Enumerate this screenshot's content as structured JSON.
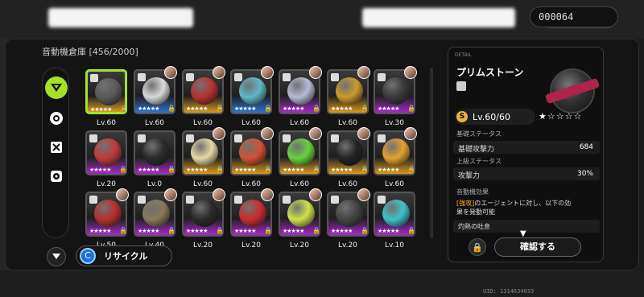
{
  "header": {
    "counter": "000064"
  },
  "storage": {
    "title": "音動機倉庫 [456/2000]"
  },
  "rail": {
    "icons": [
      "emblem-icon",
      "disc-icon",
      "crossed-box-icon",
      "disc-tool-icon"
    ]
  },
  "grid": {
    "rows": [
      [
        {
          "rank": "s",
          "level": "Lv.60",
          "avatar": false,
          "selected": true,
          "orb": "#5a5a5a"
        },
        {
          "rank": "b",
          "level": "Lv.60",
          "avatar": true,
          "selected": false,
          "orb": "#d9d9d9"
        },
        {
          "rank": "s",
          "level": "Lv.60",
          "avatar": true,
          "selected": false,
          "orb": "#b9322f"
        },
        {
          "rank": "b",
          "level": "Lv.60",
          "avatar": true,
          "selected": false,
          "orb": "#5fb8c9"
        },
        {
          "rank": "a",
          "level": "Lv.60",
          "avatar": true,
          "selected": false,
          "orb": "#b7bcd6"
        },
        {
          "rank": "s",
          "level": "Lv.60",
          "avatar": true,
          "selected": false,
          "orb": "#cc9a2e"
        },
        {
          "rank": "a",
          "level": "Lv.30",
          "avatar": true,
          "selected": false,
          "orb": "#3a3a3a"
        }
      ],
      [
        {
          "rank": "a",
          "level": "Lv.20",
          "avatar": false,
          "selected": false,
          "orb": "#c13b3b"
        },
        {
          "rank": "a",
          "level": "Lv.0",
          "avatar": false,
          "selected": false,
          "orb": "#2b2b2b"
        },
        {
          "rank": "s",
          "level": "Lv.60",
          "avatar": true,
          "selected": false,
          "orb": "#e6d9a3"
        },
        {
          "rank": "s",
          "level": "Lv.60",
          "avatar": true,
          "selected": false,
          "orb": "#d25134"
        },
        {
          "rank": "s",
          "level": "Lv.60",
          "avatar": true,
          "selected": false,
          "orb": "#6ad23f"
        },
        {
          "rank": "s",
          "level": "Lv.60",
          "avatar": true,
          "selected": false,
          "orb": "#222222"
        },
        {
          "rank": "s",
          "level": "Lv.60",
          "avatar": true,
          "selected": false,
          "orb": "#e4a12f"
        }
      ],
      [
        {
          "rank": "a",
          "level": "Lv.50",
          "avatar": true,
          "selected": false,
          "orb": "#b8302c"
        },
        {
          "rank": "a",
          "level": "Lv.40",
          "avatar": true,
          "selected": false,
          "orb": "#8a7a5c"
        },
        {
          "rank": "a",
          "level": "Lv.20",
          "avatar": true,
          "selected": false,
          "orb": "#2a2a2a"
        },
        {
          "rank": "a",
          "level": "Lv.20",
          "avatar": true,
          "selected": false,
          "orb": "#c92d2d"
        },
        {
          "rank": "a",
          "level": "Lv.20",
          "avatar": true,
          "selected": false,
          "orb": "#cfe24a"
        },
        {
          "rank": "a",
          "level": "Lv.20",
          "avatar": true,
          "selected": false,
          "orb": "#444444"
        },
        {
          "rank": "a",
          "level": "Lv.10",
          "avatar": false,
          "selected": false,
          "orb": "#3fc1c9"
        }
      ]
    ],
    "stars": "★★★★★"
  },
  "controls": {
    "recycle_label": "リサイクル",
    "recycle_icon": "C"
  },
  "detail": {
    "small_label": "DETAIL",
    "name": "プリムストーン",
    "level": "Lv.60/60",
    "coin": "S",
    "stars": "★☆☆☆☆",
    "base_section": "基礎ステータス",
    "base_stat": {
      "key": "基礎攻撃力",
      "value": "684"
    },
    "adv_section": "上級ステータス",
    "adv_stat": {
      "key": "攻撃力",
      "value": "30%"
    },
    "effect_section": "音動機効果",
    "effect_tag": "[強攻]",
    "effect_line1_rest": "のエージェントに対し、以下の効",
    "effect_line2": "果を発動可能",
    "effect_name": "灼熱の吐息",
    "confirm_label": "確認する",
    "lock_icon": "🔒"
  },
  "footer": {
    "uid": "UID: 1314634033"
  }
}
